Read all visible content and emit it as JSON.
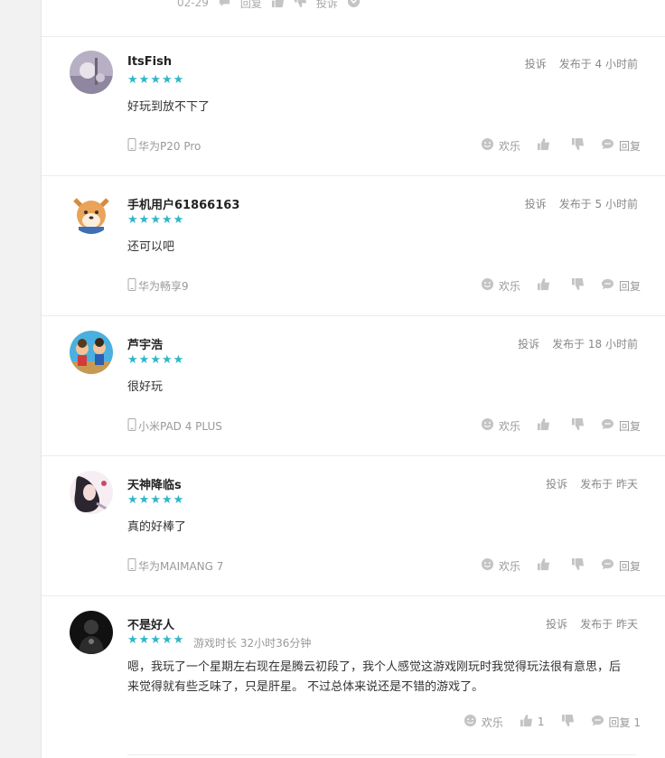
{
  "top_partial": {
    "date": "02-29",
    "reply_label": "回复",
    "report_label": "投诉"
  },
  "colors": {
    "star": "#2fb6c8",
    "muted": "#999999"
  },
  "reviews": [
    {
      "user": "ItsFish",
      "rating": 5,
      "play_time": "",
      "report": "投诉",
      "posted": "发布于 4 小时前",
      "content": "好玩到放不下了",
      "device": "华为P20 Pro",
      "fun_label": "欢乐",
      "like_count": "",
      "reply_label": "回复"
    },
    {
      "user": "手机用户61866163",
      "rating": 5,
      "play_time": "",
      "report": "投诉",
      "posted": "发布于 5 小时前",
      "content": "还可以吧",
      "device": "华为畅享9",
      "fun_label": "欢乐",
      "like_count": "",
      "reply_label": "回复"
    },
    {
      "user": "芦宇浩",
      "rating": 5,
      "play_time": "",
      "report": "投诉",
      "posted": "发布于 18 小时前",
      "content": "很好玩",
      "device": "小米PAD 4 PLUS",
      "fun_label": "欢乐",
      "like_count": "",
      "reply_label": "回复"
    },
    {
      "user": "天神降临s",
      "rating": 5,
      "play_time": "",
      "report": "投诉",
      "posted": "发布于 昨天",
      "content": "真的好棒了",
      "device": "华为MAIMANG 7",
      "fun_label": "欢乐",
      "like_count": "",
      "reply_label": "回复"
    },
    {
      "user": "不是好人",
      "rating": 5,
      "play_time": "游戏时长 32小时36分钟",
      "report": "投诉",
      "posted": "发布于 昨天",
      "content": "嗯，我玩了一个星期左右现在是腾云初段了，我个人感觉这游戏刚玩时我觉得玩法很有意思，后来觉得就有些乏味了，只是肝星。 不过总体来说还是不错的游戏了。",
      "device": "",
      "fun_label": "欢乐",
      "like_count": "1",
      "reply_label": "回复 1"
    }
  ]
}
